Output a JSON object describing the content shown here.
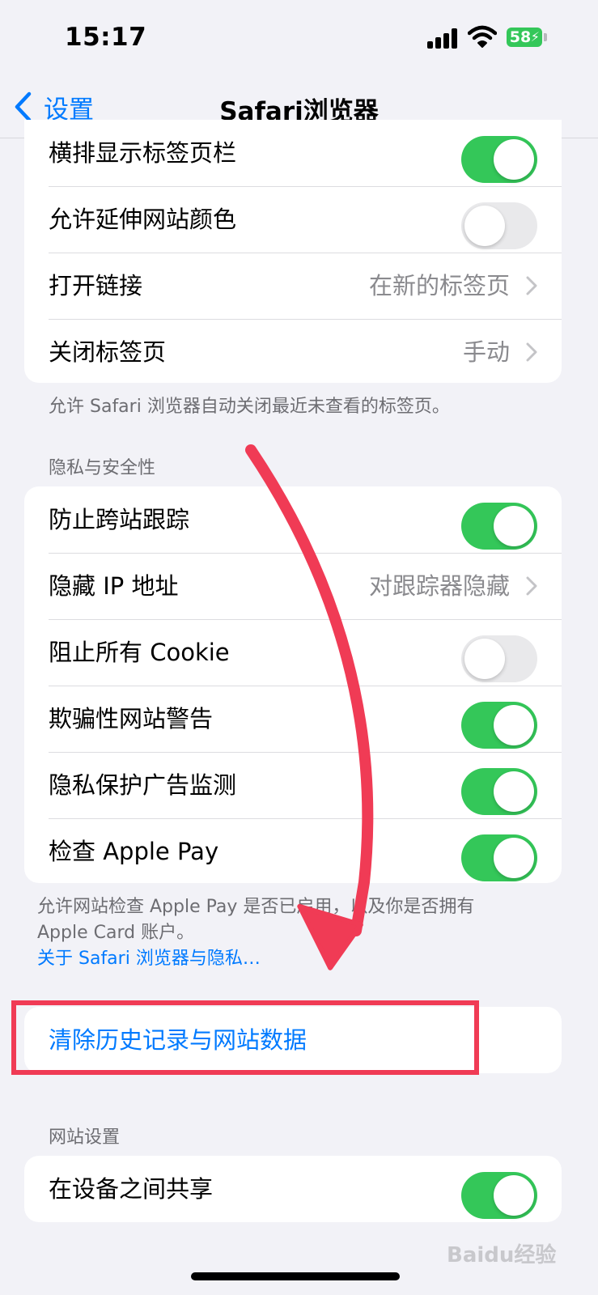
{
  "status_bar": {
    "time": "15:17",
    "battery": "58"
  },
  "nav": {
    "back_label": "设置",
    "title": "Safari浏览器"
  },
  "tabs_group": {
    "rows": [
      {
        "label": "横排显示标签页栏",
        "toggle": true
      },
      {
        "label": "允许延伸网站颜色",
        "toggle": false
      },
      {
        "label": "打开链接",
        "value": "在新的标签页"
      },
      {
        "label": "关闭标签页",
        "value": "手动"
      }
    ],
    "footnote": "允许 Safari 浏览器自动关闭最近未查看的标签页。"
  },
  "privacy_group": {
    "header": "隐私与安全性",
    "rows": [
      {
        "label": "防止跨站跟踪",
        "toggle": true
      },
      {
        "label": "隐藏 IP 地址",
        "value": "对跟踪器隐藏"
      },
      {
        "label": "阻止所有 Cookie",
        "toggle": false
      },
      {
        "label": "欺骗性网站警告",
        "toggle": true
      },
      {
        "label": "隐私保护广告监测",
        "toggle": true
      },
      {
        "label": "检查 Apple Pay",
        "toggle": true
      }
    ],
    "footnote_line1": "允许网站检查 Apple Pay 是否已启用，以及你是否拥有",
    "footnote_line2": "Apple Card 账户。",
    "footnote_link": "关于 Safari 浏览器与隐私…"
  },
  "clear_group": {
    "action": "清除历史记录与网站数据"
  },
  "website_group": {
    "header": "网站设置",
    "rows": [
      {
        "label": "在设备之间共享",
        "toggle": true
      }
    ]
  },
  "watermark": "Baidu经验",
  "colors": {
    "accent": "#007aff",
    "toggle_on": "#34c759",
    "annotation": "#f03b55"
  }
}
